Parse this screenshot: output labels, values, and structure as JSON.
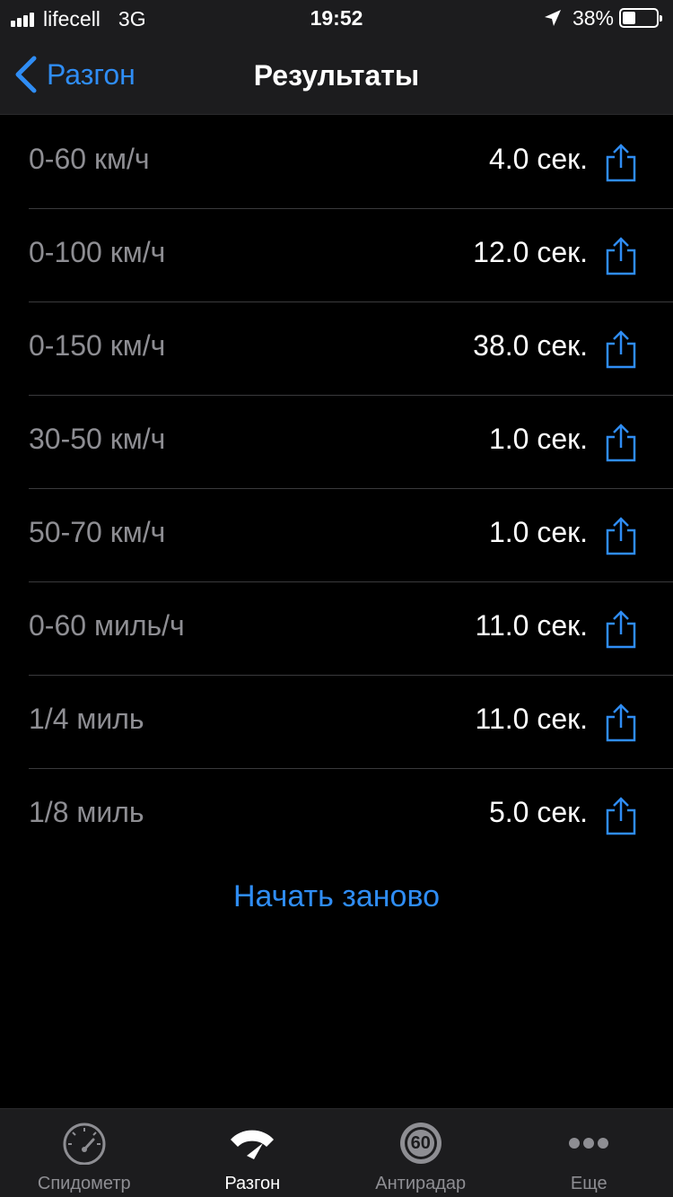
{
  "status_bar": {
    "carrier": "lifecell",
    "network": "3G",
    "time": "19:52",
    "battery_percent": "38%",
    "battery_level": 0.38
  },
  "nav": {
    "back_label": "Разгон",
    "title": "Результаты"
  },
  "results": [
    {
      "label": "0-60 км/ч",
      "value": "4.0 сек."
    },
    {
      "label": "0-100 км/ч",
      "value": "12.0 сек."
    },
    {
      "label": "0-150 км/ч",
      "value": "38.0 сек."
    },
    {
      "label": "30-50 км/ч",
      "value": "1.0 сек."
    },
    {
      "label": "50-70 км/ч",
      "value": "1.0 сек."
    },
    {
      "label": "0-60 миль/ч",
      "value": "11.0 сек."
    },
    {
      "label": "1/4 миль",
      "value": "11.0 сек."
    },
    {
      "label": "1/8 миль",
      "value": "5.0 сек."
    }
  ],
  "restart_label": "Начать заново",
  "tabs": [
    {
      "label": "Спидометр",
      "icon": "speedometer-icon",
      "active": false
    },
    {
      "label": "Разгон",
      "icon": "acceleration-icon",
      "active": true
    },
    {
      "label": "Антирадар",
      "icon": "speed-limit-icon",
      "active": false,
      "badge": "60"
    },
    {
      "label": "Еще",
      "icon": "more-icon",
      "active": false
    }
  ],
  "colors": {
    "accent": "#2f8df5",
    "background": "#000000",
    "bar": "#1c1c1e",
    "secondary_text": "#8e8e93"
  }
}
